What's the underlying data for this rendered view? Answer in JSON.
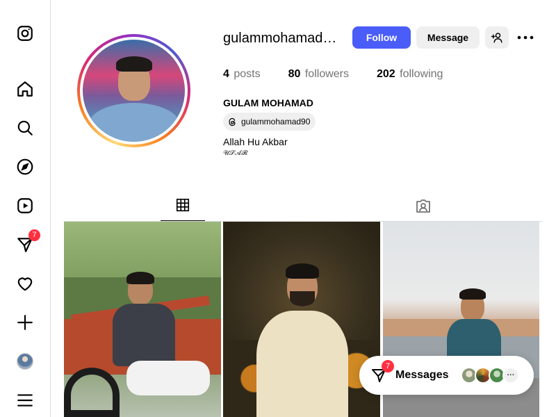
{
  "sidebar": {
    "items": [
      {
        "name": "instagram-icon"
      },
      {
        "name": "home-icon"
      },
      {
        "name": "search-icon"
      },
      {
        "name": "explore-icon"
      },
      {
        "name": "reels-icon"
      },
      {
        "name": "messenger-icon",
        "badge": "7"
      },
      {
        "name": "heart-icon"
      },
      {
        "name": "create-icon"
      },
      {
        "name": "profile-avatar"
      },
      {
        "name": "menu-icon"
      }
    ]
  },
  "profile": {
    "username": "gulammohamad…",
    "follow_label": "Follow",
    "message_label": "Message",
    "stats": [
      {
        "num": "4",
        "label": "posts"
      },
      {
        "num": "80",
        "label": "followers"
      },
      {
        "num": "202",
        "label": "following"
      }
    ],
    "full_name": "GULAM MOHAMAD",
    "threads_handle": "gulammohamad90",
    "bio": "Allah Hu Akbar",
    "bio_sub": "𝓤𝓢𝓐𝓡"
  },
  "messages": {
    "label": "Messages",
    "badge": "7",
    "more": "···"
  },
  "colors": {
    "accent": "#4a5df9",
    "badge": "#ff3040",
    "muted": "#737373",
    "border": "#dbdbdb"
  }
}
